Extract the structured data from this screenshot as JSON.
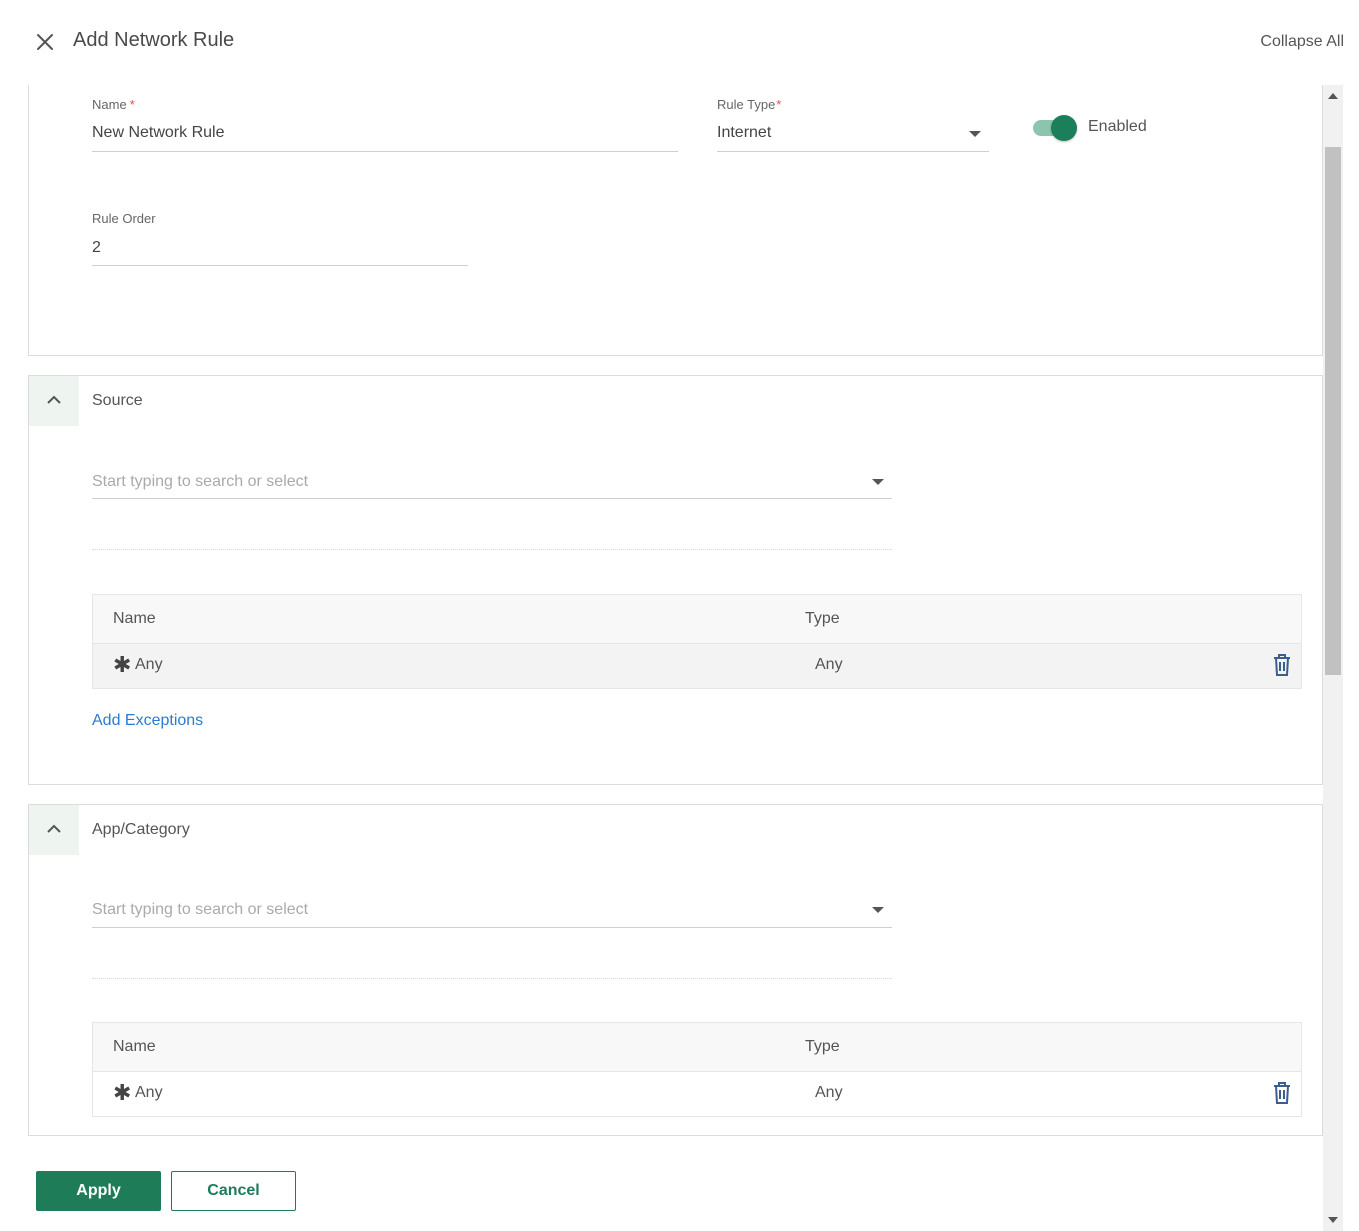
{
  "header": {
    "title": "Add Network Rule",
    "collapse_all": "Collapse All"
  },
  "general": {
    "name_label": "Name",
    "name_value": "New Network Rule",
    "rule_type_label": "Rule Type",
    "rule_type_value": "Internet",
    "required_mark": "*",
    "enabled_label": "Enabled",
    "enabled": true,
    "rule_order_label": "Rule Order",
    "rule_order_value": "2"
  },
  "source": {
    "title": "Source",
    "search_placeholder": "Start typing to search or select",
    "table": {
      "columns": [
        "Name",
        "Type"
      ],
      "rows": [
        {
          "name": "Any",
          "type": "Any"
        }
      ]
    },
    "add_exceptions": "Add Exceptions"
  },
  "app_category": {
    "title": "App/Category",
    "search_placeholder": "Start typing to search or select",
    "table": {
      "columns": [
        "Name",
        "Type"
      ],
      "rows": [
        {
          "name": "Any",
          "type": "Any"
        }
      ]
    }
  },
  "footer": {
    "apply_label": "Apply",
    "cancel_label": "Cancel"
  },
  "colors": {
    "primary": "#1e7d58",
    "link": "#2b7bd2",
    "required": "#d9534f"
  },
  "icons": {
    "close": "close-icon",
    "collapse": "chevron-up-icon",
    "dropdown": "caret-down-icon",
    "any": "asterisk-icon",
    "delete": "trash-icon"
  }
}
